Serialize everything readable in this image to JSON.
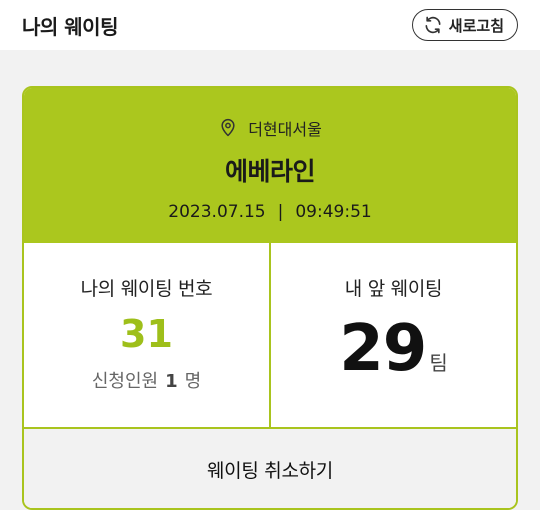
{
  "header": {
    "title": "나의 웨이팅",
    "refresh_label": "새로고침",
    "refresh_icon": "refresh-icon"
  },
  "store": {
    "location_icon": "location-pin-icon",
    "location": "더현대서울",
    "name": "에베라인",
    "date": "2023.07.15",
    "time": "09:49:51"
  },
  "my_waiting": {
    "label": "나의 웨이팅 번호",
    "number": "31",
    "party_label": "신청인원",
    "party_count": "1",
    "party_unit": "명"
  },
  "ahead": {
    "label": "내 앞 웨이팅",
    "count": "29",
    "unit": "팀"
  },
  "cancel_label": "웨이팅 취소하기",
  "colors": {
    "accent": "#abc71e",
    "number_green": "#9ebf1a",
    "background": "#f2f2f2"
  }
}
